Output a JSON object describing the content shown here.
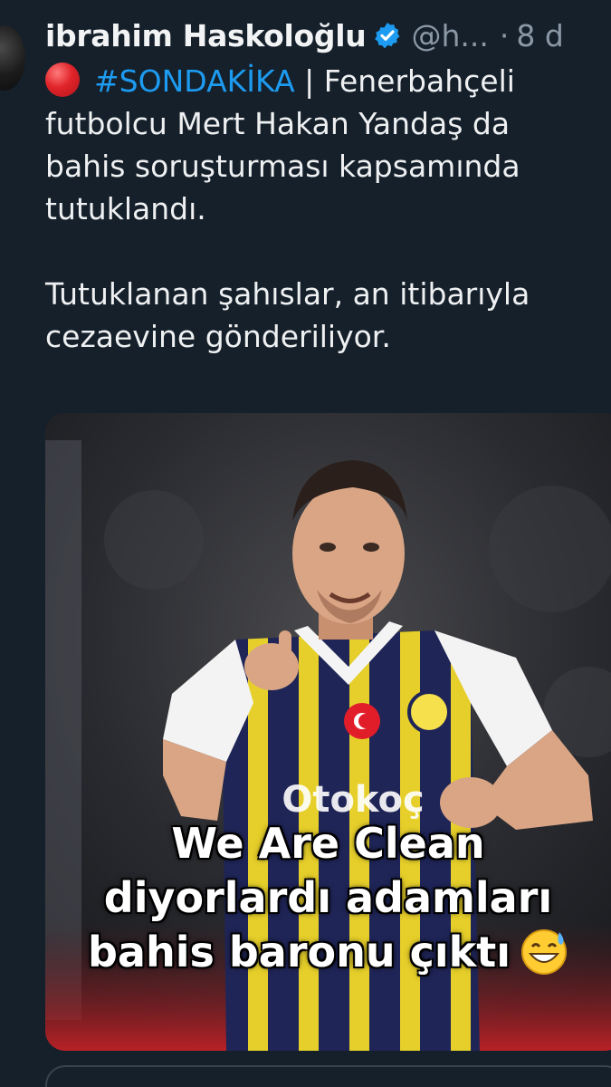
{
  "tweet": {
    "author_name": "ibrahim Haskoloğlu",
    "handle": "@h...",
    "separator": "·",
    "time": "8 d",
    "hashtag": "#SONDAKİKA",
    "lines": [
      " | Fenerbahçeli",
      "futbolcu Mert Hakan Yandaş da",
      "bahis soruşturması kapsamında",
      "tutuklandı.",
      "Tutuklanan şahıslar, an itibarıyla",
      "cezaevine gönderiliyor."
    ]
  },
  "media": {
    "caption_lines": [
      "We Are Clean",
      "diyorlardı adamları",
      "bahis baronu çıktı"
    ],
    "jersey_sponsor": "Otokoç"
  },
  "icons": {
    "verified": "verified-badge-icon",
    "alert": "red-circle-icon",
    "emoji": "grinning-sweat-emoji"
  },
  "colors": {
    "background": "#15202b",
    "hashtag": "#1d9bf0",
    "secondary_text": "#8b98a5",
    "verified": "#1d9bf0"
  }
}
